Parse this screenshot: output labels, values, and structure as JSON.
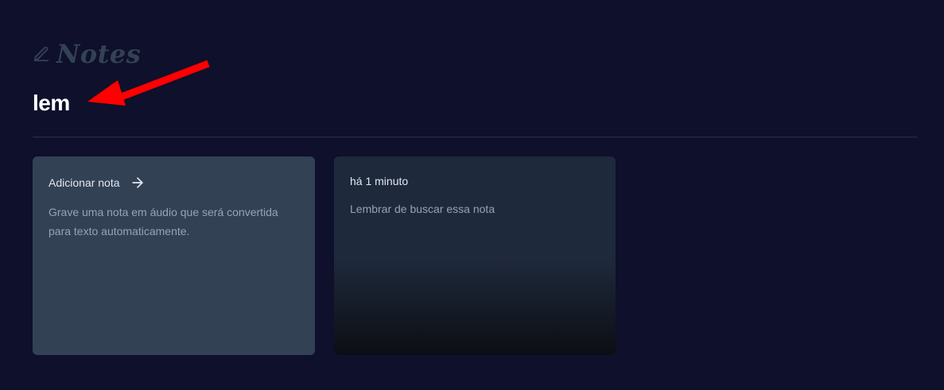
{
  "header": {
    "logo_text": "Notes",
    "logo_icon": "pen-icon"
  },
  "search": {
    "value": "lem"
  },
  "annotation": {
    "color": "#ff0000",
    "icon": "red-arrow-icon"
  },
  "cards": {
    "add": {
      "title": "Adicionar nota",
      "icon": "arrow-right-icon",
      "description": "Grave uma nota em áudio que será convertida para texto automaticamente."
    },
    "note": {
      "date": "há 1 minuto",
      "content": "Lembrar de buscar essa nota"
    }
  },
  "colors": {
    "background": "#0f102b",
    "card_add": "#334155",
    "card_note": "#1e293b",
    "logo": "#334155"
  }
}
